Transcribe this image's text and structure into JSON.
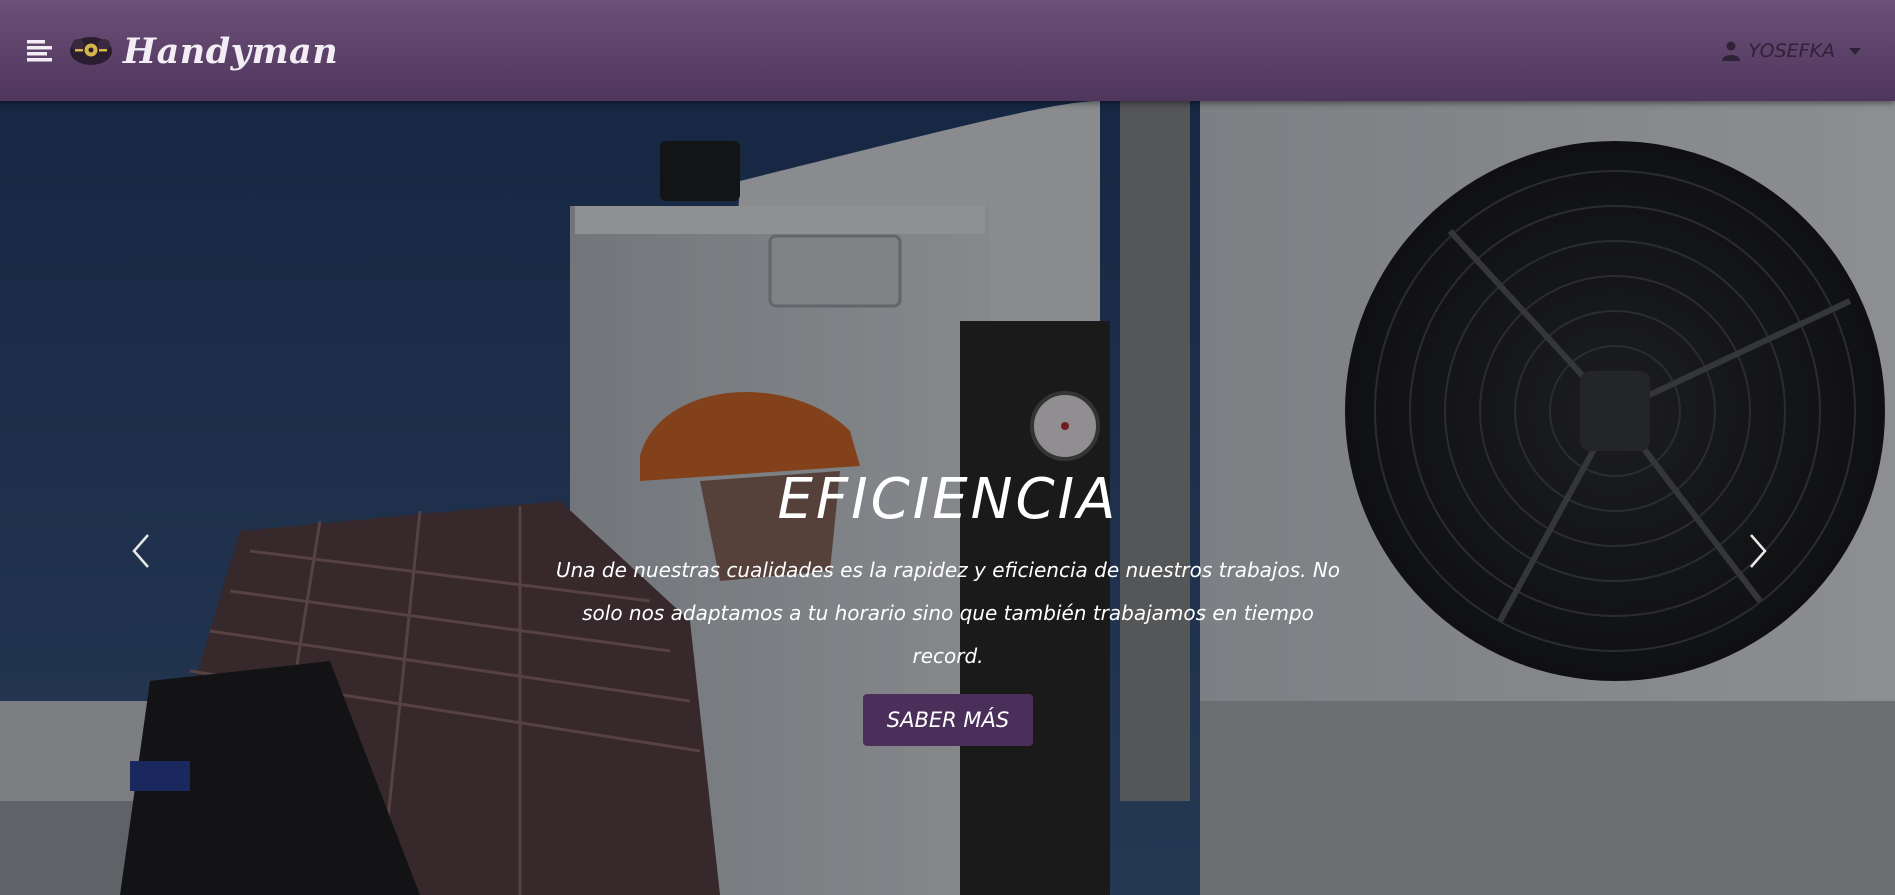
{
  "header": {
    "brand_name": "Handyman",
    "user_name": "YOSEFKA"
  },
  "icons": {
    "menu": "hamburger-menu-icon",
    "logo": "handyman-logo",
    "user": "user-icon",
    "caret": "caret-down-icon",
    "prev": "chevron-left-icon",
    "next": "chevron-right-icon"
  },
  "hero": {
    "title": "EFICIENCIA",
    "text": "Una de nuestras cualidades es la rapidez y eficiencia de nuestros trabajos. No solo nos adaptamos a tu horario sino que también trabajamos en tiempo record.",
    "cta_label": "SABER MÁS"
  },
  "colors": {
    "navbar": "#5c4169",
    "button": "#4a2f5a",
    "text": "#ffffff"
  }
}
